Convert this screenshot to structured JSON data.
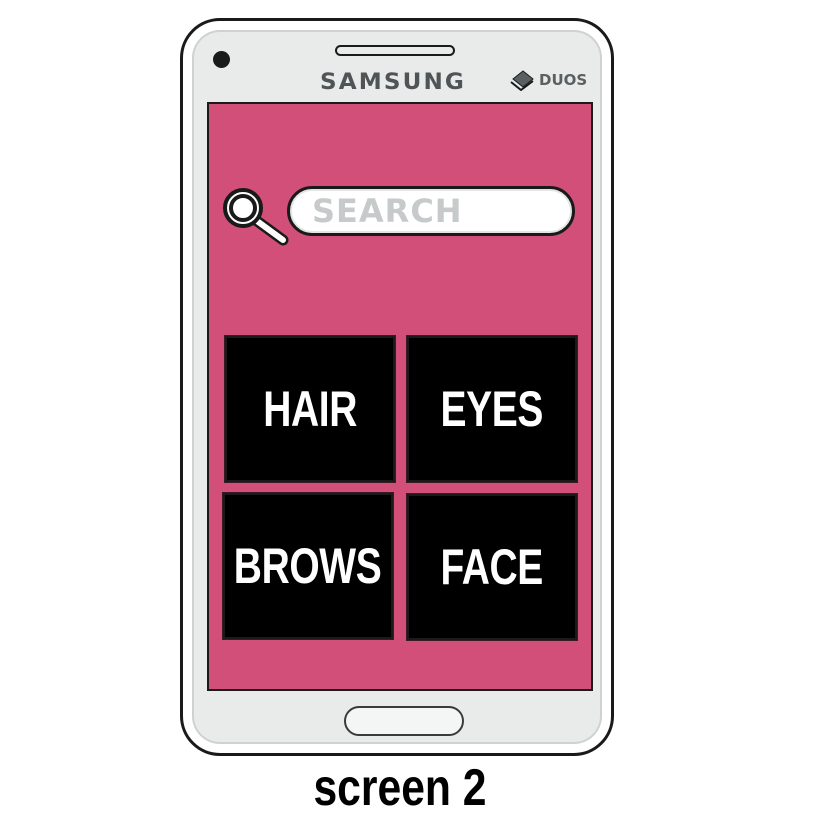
{
  "device": {
    "brand": "SAMSUNG",
    "badge": "DUOS",
    "badge_icon": "duos-sim-icon"
  },
  "screen": {
    "background_color": "#d14f78",
    "search": {
      "placeholder": "SEARCH",
      "icon": "search-icon"
    },
    "tiles": [
      {
        "label": "HAIR"
      },
      {
        "label": "EYES"
      },
      {
        "label": "BROWS"
      },
      {
        "label": "FACE"
      }
    ]
  },
  "caption": "screen 2"
}
